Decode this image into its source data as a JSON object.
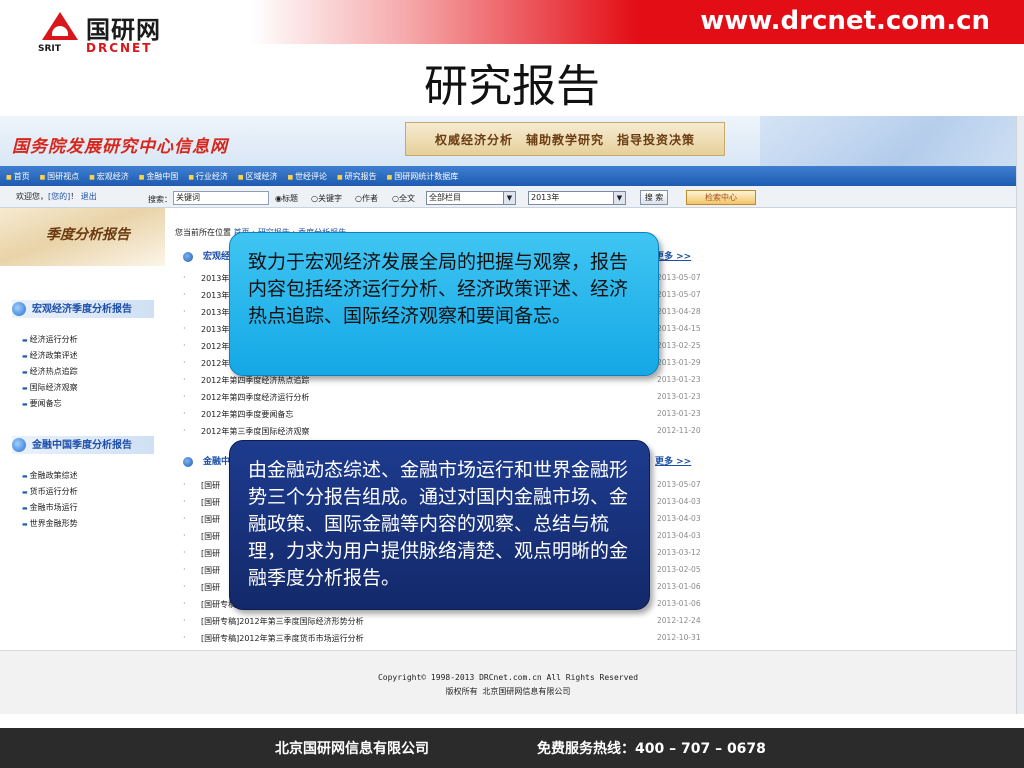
{
  "header": {
    "logo_cn": "国研网",
    "logo_srit": "SRIT",
    "logo_en": "DRCNET",
    "url": "www.drcnet.com.cn",
    "title": "研究报告"
  },
  "site": {
    "title": "国务院发展研究中心信息网",
    "slogan": "权威经济分析　辅助教学研究　指导投资决策",
    "nav": [
      "首页",
      "国研视点",
      "宏观经济",
      "金融中国",
      "行业经济",
      "区域经济",
      "世经评论",
      "研究报告",
      "国研网统计数据库"
    ]
  },
  "toolbar": {
    "welcome": "欢迎您，",
    "user": "[您的]",
    "sep": "！ ",
    "logout": "退出",
    "search_label": "搜索：",
    "keyword": "关键词",
    "radios": [
      "标题",
      "关键字",
      "作者",
      "全文"
    ],
    "column_select": "全部栏目",
    "year_select": "2013年",
    "search_btn": "搜 索",
    "center_btn": "检索中心"
  },
  "sidebar": {
    "banner": "季度分析报告",
    "sections": [
      {
        "title": "宏观经济季度分析报告",
        "items": [
          "经济运行分析",
          "经济政策评述",
          "经济热点追踪",
          "国际经济观察",
          "要闻备忘"
        ]
      },
      {
        "title": "金融中国季度分析报告",
        "items": [
          "金融政策综述",
          "货币运行分析",
          "金融市场运行",
          "世界金融形势"
        ]
      }
    ]
  },
  "breadcrumb": {
    "prefix": "您当前所在位置",
    "items": [
      "首页",
      "研究报告",
      "季度分析报告"
    ]
  },
  "main": {
    "more": "更多 >>",
    "sections": [
      {
        "title": "宏观经济季度分析报告",
        "rows": [
          {
            "title": "2013年",
            "date": "2013-05-07"
          },
          {
            "title": "2013年",
            "date": "2013-05-07"
          },
          {
            "title": "2013年",
            "date": "2013-04-28"
          },
          {
            "title": "2013年",
            "date": "2013-04-15"
          },
          {
            "title": "2012年",
            "date": "2013-02-25"
          },
          {
            "title": "2012年",
            "date": "2013-01-29"
          },
          {
            "title": "2012年第四季度经济热点追踪",
            "date": "2013-01-23"
          },
          {
            "title": "2012年第四季度经济运行分析",
            "date": "2013-01-23"
          },
          {
            "title": "2012年第四季度要闻备忘",
            "date": "2013-01-23"
          },
          {
            "title": "2012年第三季度国际经济观察",
            "date": "2012-11-20"
          }
        ]
      },
      {
        "title": "金融中国季度分析报告",
        "rows": [
          {
            "title": "[国研",
            "date": "2013-05-07"
          },
          {
            "title": "[国研",
            "date": "2013-04-03"
          },
          {
            "title": "[国研",
            "date": "2013-04-03"
          },
          {
            "title": "[国研",
            "date": "2013-04-03"
          },
          {
            "title": "[国研",
            "date": "2013-03-12"
          },
          {
            "title": "[国研",
            "date": "2013-02-05"
          },
          {
            "title": "[国研",
            "date": "2013-01-06"
          },
          {
            "title": "[国研专稿",
            "date": "2013-01-06"
          },
          {
            "title": "[国研专稿]2012年第三季度国际经济形势分析",
            "date": "2012-12-24"
          },
          {
            "title": "[国研专稿]2012年第三季度货币市场运行分析",
            "date": "2012-10-31"
          }
        ]
      }
    ]
  },
  "footer": {
    "copyright": "Copyright© 1998-2013 DRCnet.com.cn All Rights Reserved",
    "owner": "版权所有 北京国研网信息有限公司"
  },
  "callouts": [
    "致力于宏观经济发展全局的把握与观察，报告内容包括经济运行分析、经济政策评述、经济热点追踪、国际经济观察和要闻备忘。",
    "由金融动态综述、金融市场运行和世界金融形势三个分报告组成。通过对国内金融市场、金融政策、国际金融等内容的观察、总结与梳理，力求为用户提供脉络清楚、观点明晰的金融季度分析报告。"
  ],
  "bottom": {
    "company": "北京国研网信息有限公司",
    "hotline": "免费服务热线：400 – 707 – 0678"
  }
}
